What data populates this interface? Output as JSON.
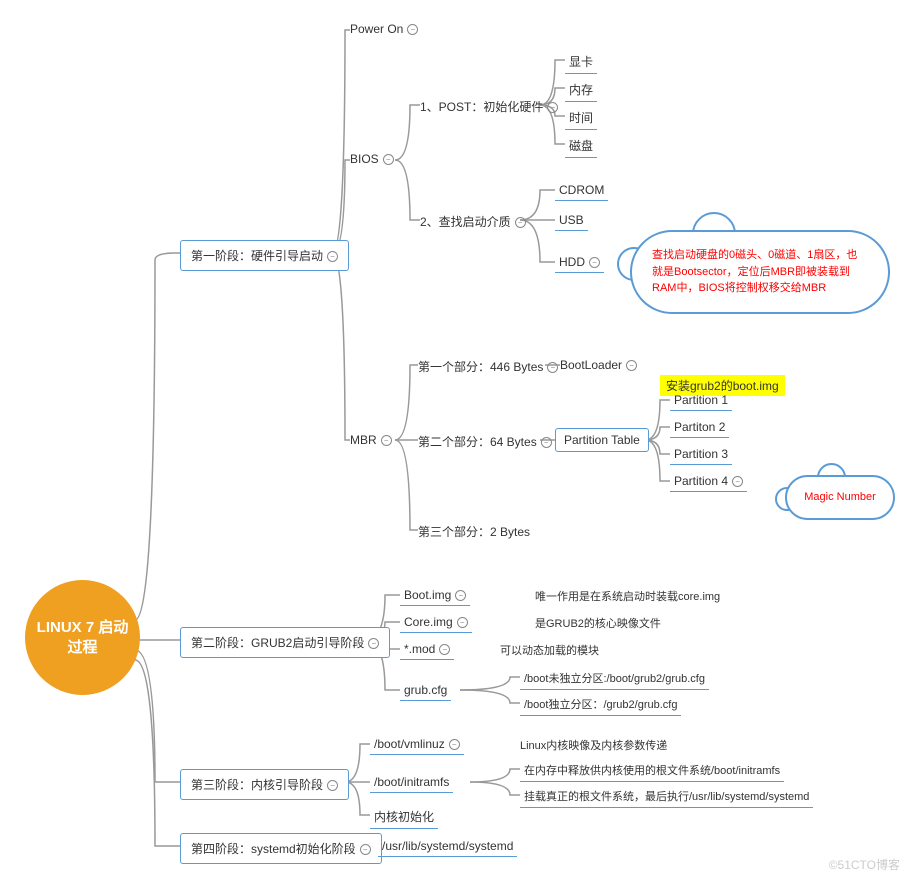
{
  "root": "LINUX 7 启动过程",
  "stage1": "第一阶段：硬件引导启动",
  "poweron": "Power On",
  "bios": "BIOS",
  "post": "1、POST：初始化硬件",
  "post_items": {
    "a": "显卡",
    "b": "内存",
    "c": "时间",
    "d": "磁盘"
  },
  "bootmedia": "2、查找启动介质",
  "media": {
    "a": "CDROM",
    "b": "USB",
    "c": "HDD"
  },
  "cloud1": "查找启动硬盘的0磁头、0磁道、1扇区，也就是Bootsector，定位后MBR即被装载到RAM中，BIOS将控制权移交给MBR",
  "mbr": "MBR",
  "mbr1": "第一个部分：446 Bytes",
  "bootloader": "BootLoader",
  "grub2img": "安装grub2的boot.img",
  "mbr2": "第二个部分：64 Bytes",
  "ptable": "Partition Table",
  "partitions": {
    "a": "Partition 1",
    "b": "Partiton 2",
    "c": "Partition 3",
    "d": "Partition 4"
  },
  "magic": "Magic Number",
  "mbr3": "第三个部分：2 Bytes",
  "stage2": "第二阶段：GRUB2启动引导阶段",
  "bootimg": "Boot.img",
  "bootimg_d": "唯一作用是在系统启动时装载core.img",
  "coreimg": "Core.img",
  "coreimg_d": "是GRUB2的核心映像文件",
  "mod": "*.mod",
  "mod_d": "可以动态加载的模块",
  "grubcfg": "grub.cfg",
  "grubcfg_a": "/boot未独立分区:/boot/grub2/grub.cfg",
  "grubcfg_b": "/boot独立分区：/grub2/grub.cfg",
  "stage3": "第三阶段：内核引导阶段",
  "vmlinuz": "/boot/vmlinuz",
  "vmlinuz_d": "Linux内核映像及内核参数传递",
  "initramfs": "/boot/initramfs",
  "initramfs_a": "在内存中释放供内核使用的根文件系统/boot/initramfs",
  "initramfs_b": "挂载真正的根文件系统，最后执行/usr/lib/systemd/systemd",
  "kernelinit": "内核初始化",
  "stage4": "第四阶段：systemd初始化阶段",
  "systemd": "/usr/lib/systemd/systemd",
  "watermark": "©51CTO博客"
}
